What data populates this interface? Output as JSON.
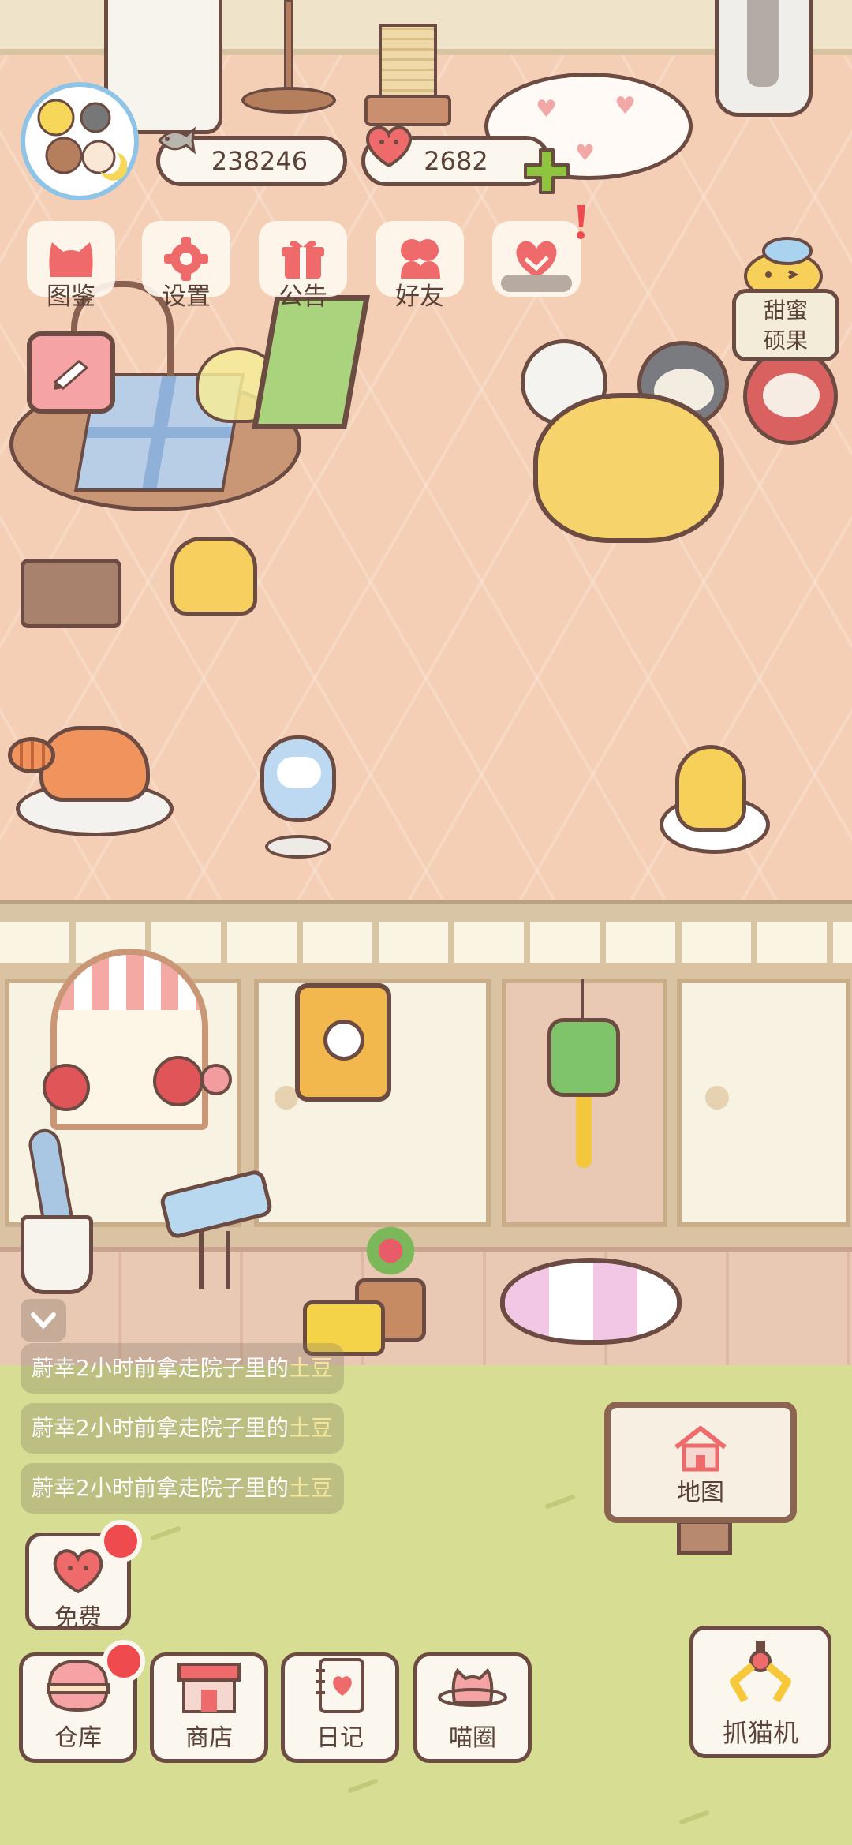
{
  "hud": {
    "fish_coins": "238246",
    "hearts": "2682"
  },
  "menu": [
    {
      "label": "图鉴",
      "icon": "cat-head-icon"
    },
    {
      "label": "设置",
      "icon": "gear-icon"
    },
    {
      "label": "公告",
      "icon": "gift-icon"
    },
    {
      "label": "好友",
      "icon": "friends-icon"
    },
    {
      "label": "",
      "icon": "heart-handshake-icon"
    }
  ],
  "event": {
    "sweet_nut_label_1": "甜蜜",
    "sweet_nut_label_2": "硕果"
  },
  "feed": [
    {
      "prefix": "蔚幸2小时前拿走院子里的",
      "item": "土豆"
    },
    {
      "prefix": "蔚幸2小时前拿走院子里的",
      "item": "土豆"
    },
    {
      "prefix": "蔚幸2小时前拿走院子里的",
      "item": "土豆"
    }
  ],
  "buttons": {
    "free": "免费",
    "map": "地图",
    "warehouse": "仓库",
    "shop": "商店",
    "diary": "日记",
    "meow_circle": "喵圈",
    "claw_machine": "抓猫机"
  },
  "colors": {
    "outline": "#6b4b42",
    "accent_pink": "#ef6b6b",
    "badge_red": "#ef4b4f",
    "plus_green": "#8fc440",
    "floor": "#f4cfb6",
    "grass": "#d7dd92"
  }
}
